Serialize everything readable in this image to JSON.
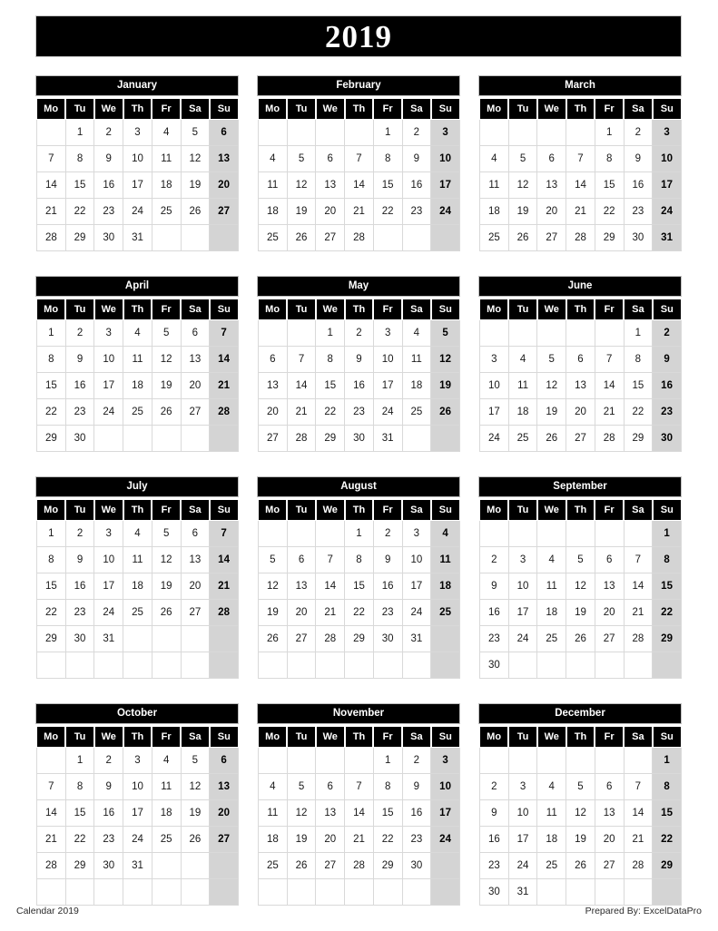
{
  "title": {
    "year": "2019"
  },
  "footer": {
    "left": "Calendar 2019",
    "right": "Prepared By: ExcelDataPro"
  },
  "weekday_headers": [
    "Mo",
    "Tu",
    "We",
    "Th",
    "Fr",
    "Sa",
    "Su"
  ],
  "colors": {
    "header_bg": "#000000",
    "header_text": "#ffffff",
    "sunday_bg": "#d4d4d4",
    "cell_border": "#d9d9d9",
    "page_bg": "#ffffff",
    "body_text": "#1a1a1a"
  },
  "highlight_column": "Su",
  "months": [
    {
      "name": "January",
      "rows": 5,
      "weeks": [
        [
          "",
          "1",
          "2",
          "3",
          "4",
          "5",
          "6"
        ],
        [
          "7",
          "8",
          "9",
          "10",
          "11",
          "12",
          "13"
        ],
        [
          "14",
          "15",
          "16",
          "17",
          "18",
          "19",
          "20"
        ],
        [
          "21",
          "22",
          "23",
          "24",
          "25",
          "26",
          "27"
        ],
        [
          "28",
          "29",
          "30",
          "31",
          "",
          "",
          ""
        ]
      ]
    },
    {
      "name": "February",
      "rows": 5,
      "weeks": [
        [
          "",
          "",
          "",
          "",
          "1",
          "2",
          "3"
        ],
        [
          "4",
          "5",
          "6",
          "7",
          "8",
          "9",
          "10"
        ],
        [
          "11",
          "12",
          "13",
          "14",
          "15",
          "16",
          "17"
        ],
        [
          "18",
          "19",
          "20",
          "21",
          "22",
          "23",
          "24"
        ],
        [
          "25",
          "26",
          "27",
          "28",
          "",
          "",
          ""
        ]
      ]
    },
    {
      "name": "March",
      "rows": 5,
      "weeks": [
        [
          "",
          "",
          "",
          "",
          "1",
          "2",
          "3"
        ],
        [
          "4",
          "5",
          "6",
          "7",
          "8",
          "9",
          "10"
        ],
        [
          "11",
          "12",
          "13",
          "14",
          "15",
          "16",
          "17"
        ],
        [
          "18",
          "19",
          "20",
          "21",
          "22",
          "23",
          "24"
        ],
        [
          "25",
          "26",
          "27",
          "28",
          "29",
          "30",
          "31"
        ]
      ]
    },
    {
      "name": "April",
      "rows": 5,
      "weeks": [
        [
          "1",
          "2",
          "3",
          "4",
          "5",
          "6",
          "7"
        ],
        [
          "8",
          "9",
          "10",
          "11",
          "12",
          "13",
          "14"
        ],
        [
          "15",
          "16",
          "17",
          "18",
          "19",
          "20",
          "21"
        ],
        [
          "22",
          "23",
          "24",
          "25",
          "26",
          "27",
          "28"
        ],
        [
          "29",
          "30",
          "",
          "",
          "",
          "",
          ""
        ]
      ]
    },
    {
      "name": "May",
      "rows": 5,
      "weeks": [
        [
          "",
          "",
          "1",
          "2",
          "3",
          "4",
          "5"
        ],
        [
          "6",
          "7",
          "8",
          "9",
          "10",
          "11",
          "12"
        ],
        [
          "13",
          "14",
          "15",
          "16",
          "17",
          "18",
          "19"
        ],
        [
          "20",
          "21",
          "22",
          "23",
          "24",
          "25",
          "26"
        ],
        [
          "27",
          "28",
          "29",
          "30",
          "31",
          "",
          ""
        ]
      ]
    },
    {
      "name": "June",
      "rows": 5,
      "weeks": [
        [
          "",
          "",
          "",
          "",
          "",
          "1",
          "2"
        ],
        [
          "3",
          "4",
          "5",
          "6",
          "7",
          "8",
          "9"
        ],
        [
          "10",
          "11",
          "12",
          "13",
          "14",
          "15",
          "16"
        ],
        [
          "17",
          "18",
          "19",
          "20",
          "21",
          "22",
          "23"
        ],
        [
          "24",
          "25",
          "26",
          "27",
          "28",
          "29",
          "30"
        ]
      ]
    },
    {
      "name": "July",
      "rows": 6,
      "weeks": [
        [
          "1",
          "2",
          "3",
          "4",
          "5",
          "6",
          "7"
        ],
        [
          "8",
          "9",
          "10",
          "11",
          "12",
          "13",
          "14"
        ],
        [
          "15",
          "16",
          "17",
          "18",
          "19",
          "20",
          "21"
        ],
        [
          "22",
          "23",
          "24",
          "25",
          "26",
          "27",
          "28"
        ],
        [
          "29",
          "30",
          "31",
          "",
          "",
          "",
          ""
        ],
        [
          "",
          "",
          "",
          "",
          "",
          "",
          ""
        ]
      ]
    },
    {
      "name": "August",
      "rows": 6,
      "weeks": [
        [
          "",
          "",
          "",
          "1",
          "2",
          "3",
          "4"
        ],
        [
          "5",
          "6",
          "7",
          "8",
          "9",
          "10",
          "11"
        ],
        [
          "12",
          "13",
          "14",
          "15",
          "16",
          "17",
          "18"
        ],
        [
          "19",
          "20",
          "21",
          "22",
          "23",
          "24",
          "25"
        ],
        [
          "26",
          "27",
          "28",
          "29",
          "30",
          "31",
          ""
        ],
        [
          "",
          "",
          "",
          "",
          "",
          "",
          ""
        ]
      ]
    },
    {
      "name": "September",
      "rows": 6,
      "weeks": [
        [
          "",
          "",
          "",
          "",
          "",
          "",
          "1"
        ],
        [
          "2",
          "3",
          "4",
          "5",
          "6",
          "7",
          "8"
        ],
        [
          "9",
          "10",
          "11",
          "12",
          "13",
          "14",
          "15"
        ],
        [
          "16",
          "17",
          "18",
          "19",
          "20",
          "21",
          "22"
        ],
        [
          "23",
          "24",
          "25",
          "26",
          "27",
          "28",
          "29"
        ],
        [
          "30",
          "",
          "",
          "",
          "",
          "",
          ""
        ]
      ]
    },
    {
      "name": "October",
      "rows": 6,
      "weeks": [
        [
          "",
          "1",
          "2",
          "3",
          "4",
          "5",
          "6"
        ],
        [
          "7",
          "8",
          "9",
          "10",
          "11",
          "12",
          "13"
        ],
        [
          "14",
          "15",
          "16",
          "17",
          "18",
          "19",
          "20"
        ],
        [
          "21",
          "22",
          "23",
          "24",
          "25",
          "26",
          "27"
        ],
        [
          "28",
          "29",
          "30",
          "31",
          "",
          "",
          ""
        ],
        [
          "",
          "",
          "",
          "",
          "",
          "",
          ""
        ]
      ]
    },
    {
      "name": "November",
      "rows": 6,
      "weeks": [
        [
          "",
          "",
          "",
          "",
          "1",
          "2",
          "3"
        ],
        [
          "4",
          "5",
          "6",
          "7",
          "8",
          "9",
          "10"
        ],
        [
          "11",
          "12",
          "13",
          "14",
          "15",
          "16",
          "17"
        ],
        [
          "18",
          "19",
          "20",
          "21",
          "22",
          "23",
          "24"
        ],
        [
          "25",
          "26",
          "27",
          "28",
          "29",
          "30",
          ""
        ],
        [
          "",
          "",
          "",
          "",
          "",
          "",
          ""
        ]
      ]
    },
    {
      "name": "December",
      "rows": 6,
      "weeks": [
        [
          "",
          "",
          "",
          "",
          "",
          "",
          "1"
        ],
        [
          "2",
          "3",
          "4",
          "5",
          "6",
          "7",
          "8"
        ],
        [
          "9",
          "10",
          "11",
          "12",
          "13",
          "14",
          "15"
        ],
        [
          "16",
          "17",
          "18",
          "19",
          "20",
          "21",
          "22"
        ],
        [
          "23",
          "24",
          "25",
          "26",
          "27",
          "28",
          "29"
        ],
        [
          "30",
          "31",
          "",
          "",
          "",
          "",
          ""
        ]
      ]
    }
  ]
}
